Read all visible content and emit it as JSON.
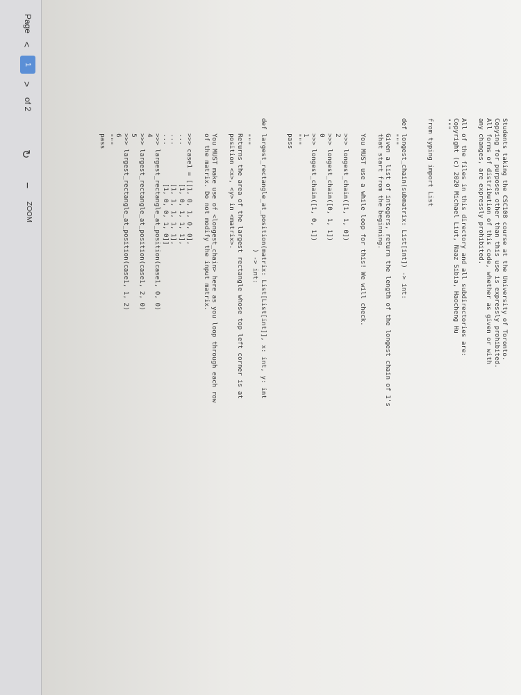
{
  "toolbar": {
    "page_label": "Page",
    "prev": "<",
    "current_page": "1",
    "next": ">",
    "of_pages": "of 2",
    "rotate_icon": "rotate-icon",
    "zoom_out": "−",
    "zoom_label": "ZOOM",
    "keyboard_delete": "delete"
  },
  "code_lines": [
    "Students taking the CSC108 course at the University of Toronto.",
    "Copying for purposes other than this use is expressly prohibited.",
    "All forms of distribution of this code, whether as given or with",
    "any changes, are expressly prohibited.",
    "",
    "All of the files in this directory and all subdirectories are:",
    "Copyright (c) 2020 Michael Liut, Naaz Sibia, Haocheng Hu",
    "\"\"\"",
    "",
    "from typing import List",
    "",
    "",
    "def longest_chain(submatrix: List[int]) -> int:",
    "    \"\"\"",
    "    Given a list of integers, return the length of the longest chain of 1's",
    "    that start from the beginning.",
    "",
    "    You MUST use a while loop for this! We will check.",
    "",
    "    >>> longest_chain([1, 1, 0])",
    "    2",
    "    >>> longest_chain([0, 1, 1])",
    "    0",
    "    >>> longest_chain([1, 0, 1])",
    "    1",
    "    \"\"\"",
    "    pass",
    "",
    "",
    "def largest_rectangle_at_position(matrix: List[List[int]], x: int, y: int",
    "                                  ) -> int:",
    "    \"\"\"",
    "    Returns the area of the largest rectangle whose top left corner is at",
    "    position <x>, <y> in <matrix>.",
    "",
    "    You MUST make use of <longest_chain> here as you loop through each row",
    "    of the matrix. Do not modify the input matrix.",
    "",
    "    >>> case1 = [[1, 0, 1, 0, 0],",
    "    ...          [1, 0, 1, 1, 1],",
    "    ...          [1, 1, 1, 1, 1],",
    "    ...          [1, 0, 0, 1, 0]]",
    "    >>> largest_rectangle_at_position(case1, 0, 0)",
    "    4",
    "    >>> largest_rectangle_at_position(case1, 2, 0)",
    "    5",
    "    >>> largest_rectangle_at_position(case1, 1, 2)",
    "    6",
    "    \"\"\"",
    "    pass"
  ]
}
